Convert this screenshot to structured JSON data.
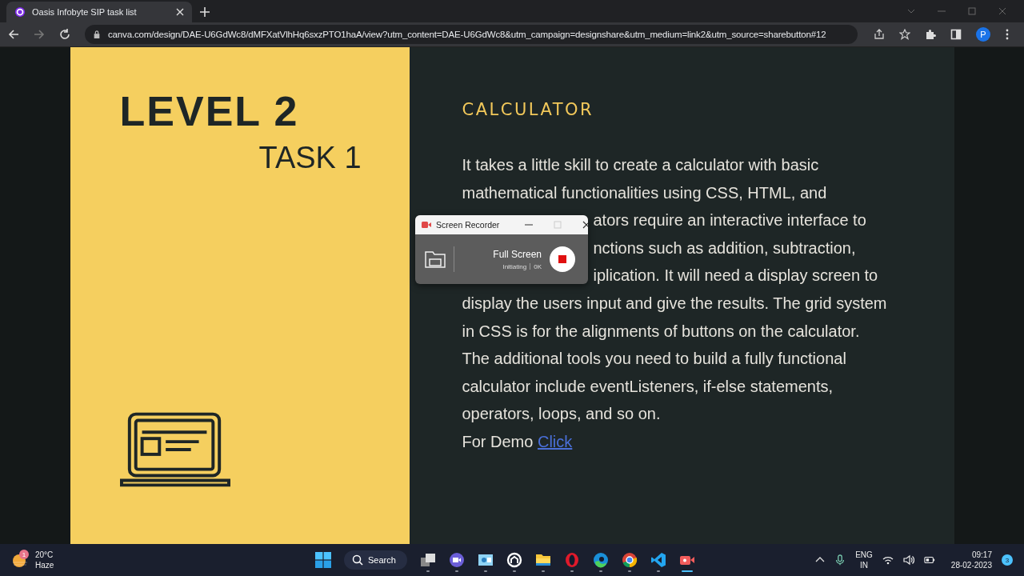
{
  "browser": {
    "tab_title": "Oasis Infobyte SIP task list",
    "url": "canva.com/design/DAE-U6GdWc8/dMFXatVlhHq6sxzPTO1haA/view?utm_content=DAE-U6GdWc8&utm_campaign=designshare&utm_medium=link2&utm_source=sharebutton#12",
    "profile_initial": "P"
  },
  "slide": {
    "heading": "LEVEL 2",
    "subheading": "TASK 1",
    "title": "CALCULATOR",
    "lines": [
      {
        "text": "It takes a little skill to create a calculator with basic",
        "kind": "full"
      },
      {
        "text": "mathematical functionalities using CSS, HTML, and",
        "kind": "full"
      },
      {
        "text": "ators require an interactive interface to",
        "kind": "partial"
      },
      {
        "text": "nctions such as addition, subtraction,",
        "kind": "partial"
      },
      {
        "text": "iplication. It will need a  display screen to",
        "kind": "partial"
      },
      {
        "text": "display the users input and give the results. The grid system",
        "kind": "full"
      },
      {
        "text": "in CSS is for the alignments of buttons on the calculator.",
        "kind": "full"
      },
      {
        "text": "The additional tools you need to build a fully functional",
        "kind": "full"
      },
      {
        "text": "calculator include eventListeners, if-else statements,",
        "kind": "full"
      },
      {
        "text": "operators, loops, and so on.",
        "kind": "full"
      }
    ],
    "demo_label": "For Demo",
    "demo_link": "Click "
  },
  "recorder": {
    "title": "Screen Recorder",
    "mode": "Full Screen",
    "status": "Initiating",
    "size": "0K"
  },
  "taskbar": {
    "temperature": "20°C",
    "weather": "Haze",
    "weather_badge": "1",
    "search": "Search",
    "apps": [
      {
        "kind": "taskview",
        "active": false
      },
      {
        "kind": "teams",
        "active": false
      },
      {
        "kind": "widgets",
        "active": false
      },
      {
        "kind": "store",
        "active": false
      },
      {
        "kind": "folder",
        "active": false
      },
      {
        "kind": "opera",
        "active": false
      },
      {
        "kind": "edge",
        "active": false
      },
      {
        "kind": "chrome",
        "active": false
      },
      {
        "kind": "vscode",
        "active": false
      },
      {
        "kind": "recorder",
        "active": true
      }
    ],
    "language": "ENG",
    "region": "IN",
    "time": "09:17",
    "date": "28-02-2023",
    "notifications": "3"
  }
}
